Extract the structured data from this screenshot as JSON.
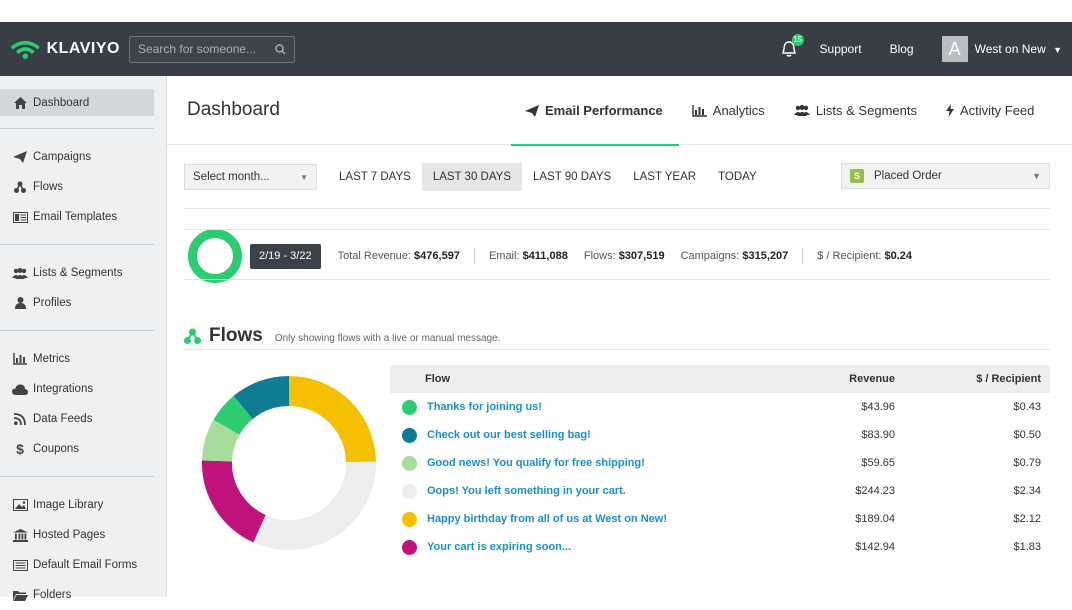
{
  "topbar": {
    "logo_text": "KLAVIYO",
    "search_placeholder": "Search for someone...",
    "notification_count": "15",
    "support": "Support",
    "blog": "Blog",
    "avatar_letter": "A",
    "account": "West on New"
  },
  "sidebar": {
    "items": [
      {
        "label": "Dashboard",
        "icon": "home-icon"
      },
      {
        "label": "Campaigns",
        "icon": "paper-plane-icon"
      },
      {
        "label": "Flows",
        "icon": "flows-icon"
      },
      {
        "label": "Email Templates",
        "icon": "email-template-icon"
      },
      {
        "label": "Lists & Segments",
        "icon": "users-icon"
      },
      {
        "label": "Profiles",
        "icon": "user-icon"
      },
      {
        "label": "Metrics",
        "icon": "bar-chart-icon"
      },
      {
        "label": "Integrations",
        "icon": "cloud-icon"
      },
      {
        "label": "Data Feeds",
        "icon": "rss-icon"
      },
      {
        "label": "Coupons",
        "icon": "dollar-icon"
      },
      {
        "label": "Image Library",
        "icon": "image-icon"
      },
      {
        "label": "Hosted Pages",
        "icon": "building-icon"
      },
      {
        "label": "Default Email Forms",
        "icon": "form-icon"
      },
      {
        "label": "Folders",
        "icon": "folder-icon"
      }
    ]
  },
  "header": {
    "title": "Dashboard",
    "tabs": [
      {
        "label": "Email Performance",
        "icon": "paper-plane-icon"
      },
      {
        "label": "Analytics",
        "icon": "bar-chart-icon"
      },
      {
        "label": "Lists & Segments",
        "icon": "users-icon"
      },
      {
        "label": "Activity Feed",
        "icon": "bolt-icon"
      }
    ]
  },
  "filters": {
    "select_month": "Select month...",
    "ranges": [
      "LAST 7 DAYS",
      "LAST 30 DAYS",
      "LAST 90 DAYS",
      "LAST YEAR",
      "TODAY"
    ],
    "active_range": "LAST 30 DAYS",
    "metric": "Placed Order"
  },
  "stats": {
    "date_range": "2/19 - 3/22",
    "total_revenue_label": "Total Revenue:",
    "total_revenue": "$476,597",
    "email_label": "Email:",
    "email": "$411,088",
    "flows_label": "Flows:",
    "flows": "$307,519",
    "campaigns_label": "Campaigns:",
    "campaigns": "$315,207",
    "per_recipient_label": "$ / Recipient:",
    "per_recipient": "$0.24"
  },
  "flows": {
    "title": "Flows",
    "note": "Only showing flows with a live or manual message.",
    "columns": {
      "flow": "Flow",
      "revenue": "Revenue",
      "per_recipient": "$ / Recipient"
    },
    "rows": [
      {
        "name": "Thanks for joining us!",
        "revenue": "$43.96",
        "per_recipient": "$0.43",
        "color": "#2ecc71"
      },
      {
        "name": "Check out our best selling bag!",
        "revenue": "$83.90",
        "per_recipient": "$0.50",
        "color": "#0e7c93"
      },
      {
        "name": "Good news! You qualify for free shipping!",
        "revenue": "$59.65",
        "per_recipient": "$0.79",
        "color": "#a8dc9a"
      },
      {
        "name": "Oops! You left something in your cart.",
        "revenue": "$244.23",
        "per_recipient": "$2.34",
        "color": "#ebedef"
      },
      {
        "name": "Happy birthday from all of us at West on New!",
        "revenue": "$189.04",
        "per_recipient": "$2.12",
        "color": "#f5c000"
      },
      {
        "name": "Your cart is expiring soon...",
        "revenue": "$142.94",
        "per_recipient": "$1.83",
        "color": "#c0127c"
      }
    ]
  },
  "colors": {
    "accent_green": "#2ecc71",
    "topbar": "#373e45",
    "link": "#1a8fc9"
  }
}
